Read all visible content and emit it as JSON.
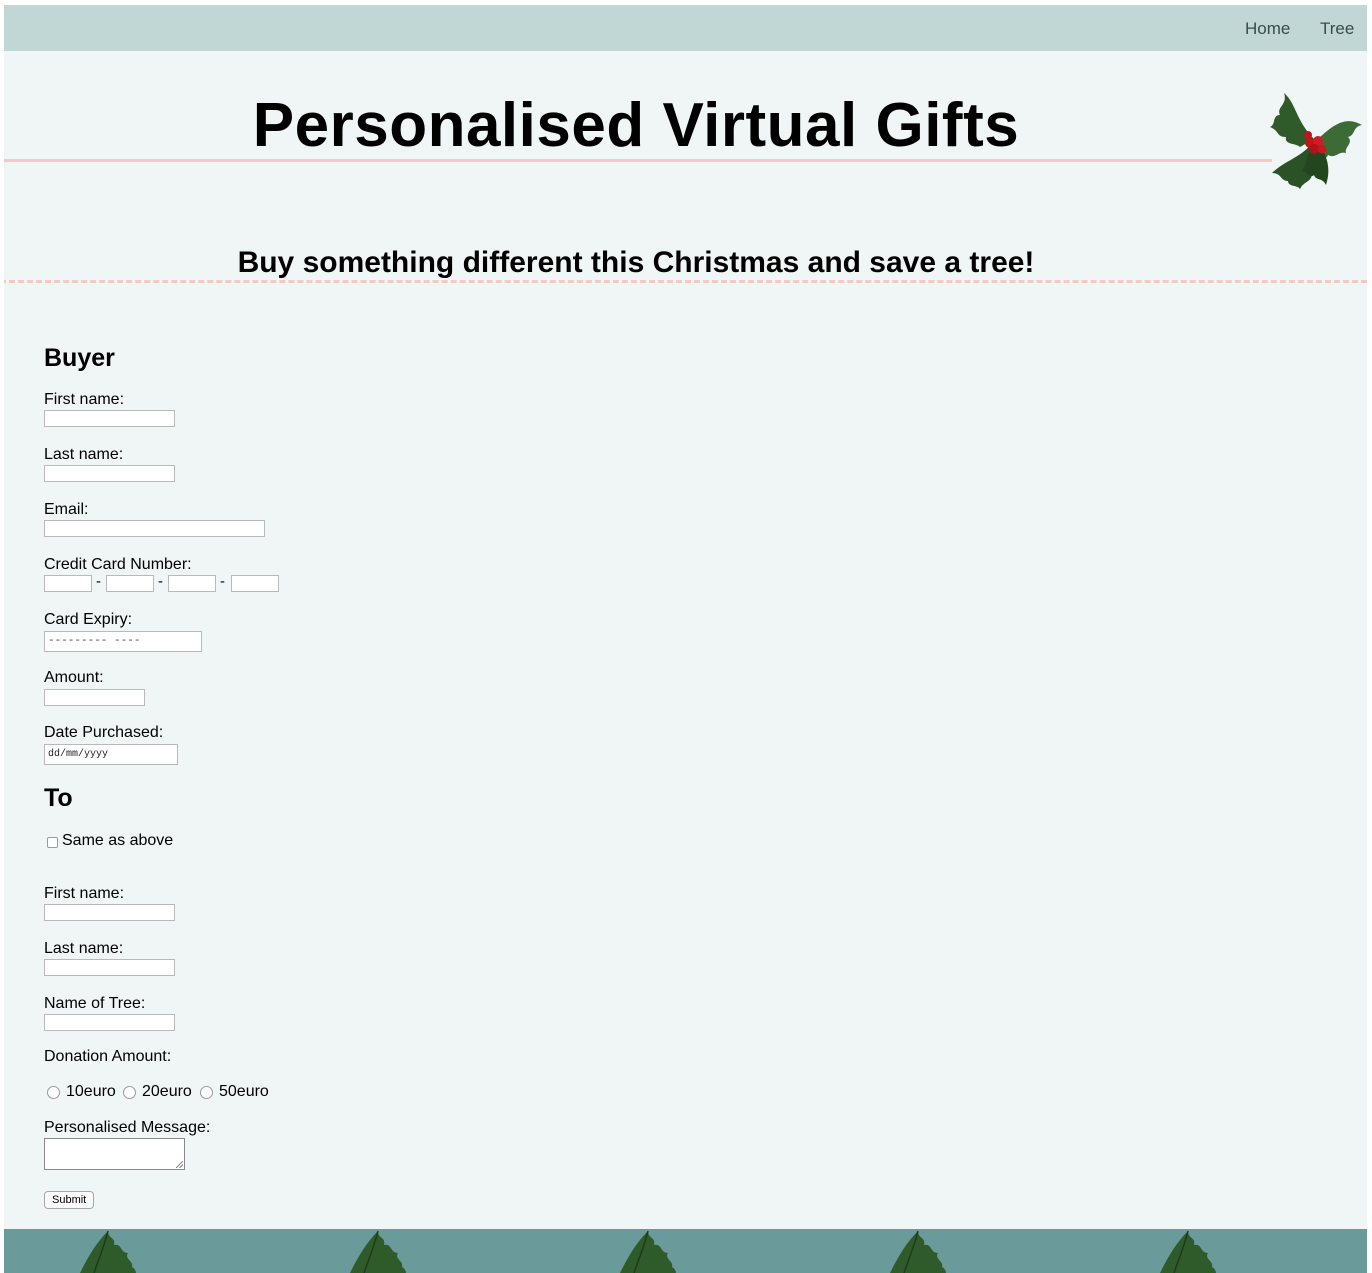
{
  "nav": {
    "home": "Home",
    "tree": "Tree"
  },
  "header": {
    "title": "Personalised Virtual Gifts",
    "subtitle": "Buy something different this Christmas and save a tree!"
  },
  "buyer": {
    "heading": "Buyer",
    "first_name_label": "First name:",
    "last_name_label": "Last name:",
    "email_label": "Email:",
    "card_number_label": "Credit Card Number:",
    "card_separator": "-",
    "card_expiry_label": "Card Expiry:",
    "card_expiry_placeholder": "---------  ----",
    "amount_label": "Amount:",
    "date_label": "Date Purchased:",
    "date_placeholder": "dd/mm/yyyy"
  },
  "to": {
    "heading": "To",
    "same_as_above": "Same as above",
    "first_name_label": "First name:",
    "last_name_label": "Last name:",
    "tree_name_label": "Name of Tree:",
    "donation_label": "Donation Amount:",
    "donation_options": [
      "10euro",
      "20euro",
      "50euro"
    ],
    "message_label": "Personalised Message:",
    "submit_label": "Submit"
  },
  "colors": {
    "page_bg": "#f0f6f5",
    "nav_bg": "#c1d7d6",
    "footer_bg": "#6b9a9a",
    "rule": "#f6c9c9"
  }
}
